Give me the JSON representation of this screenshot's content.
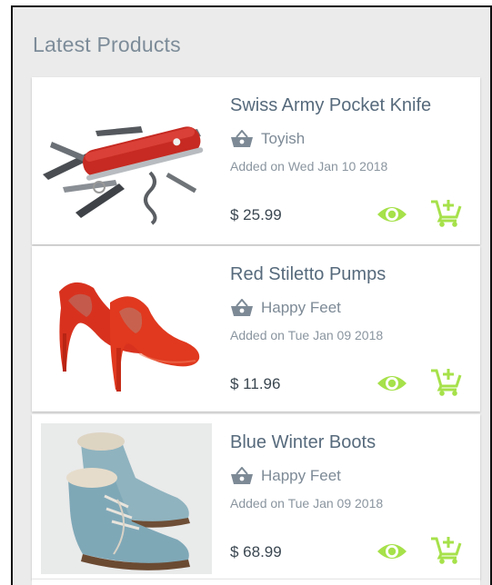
{
  "panel": {
    "title": "Latest Products"
  },
  "products": [
    {
      "name": "Swiss Army Pocket Knife",
      "shop": "Toyish",
      "added": "Added on Wed Jan 10 2018",
      "price": "$ 25.99",
      "image": "red-pocket-knife"
    },
    {
      "name": "Red Stiletto Pumps",
      "shop": "Happy Feet",
      "added": "Added on Tue Jan 09 2018",
      "price": "$ 11.96",
      "image": "red-stiletto-pumps"
    },
    {
      "name": "Blue Winter Boots",
      "shop": "Happy Feet",
      "added": "Added on Tue Jan 09 2018",
      "price": "$ 68.99",
      "image": "blue-winter-boots"
    }
  ],
  "icons": {
    "shop": "shopping-basket-icon",
    "view": "eye-icon",
    "add_to_cart": "add-shopping-cart-icon"
  },
  "colors": {
    "action": "#a6e14a",
    "title": "#7d8c99",
    "product_name": "#566a7c",
    "panel_bg": "#ebebeb"
  }
}
